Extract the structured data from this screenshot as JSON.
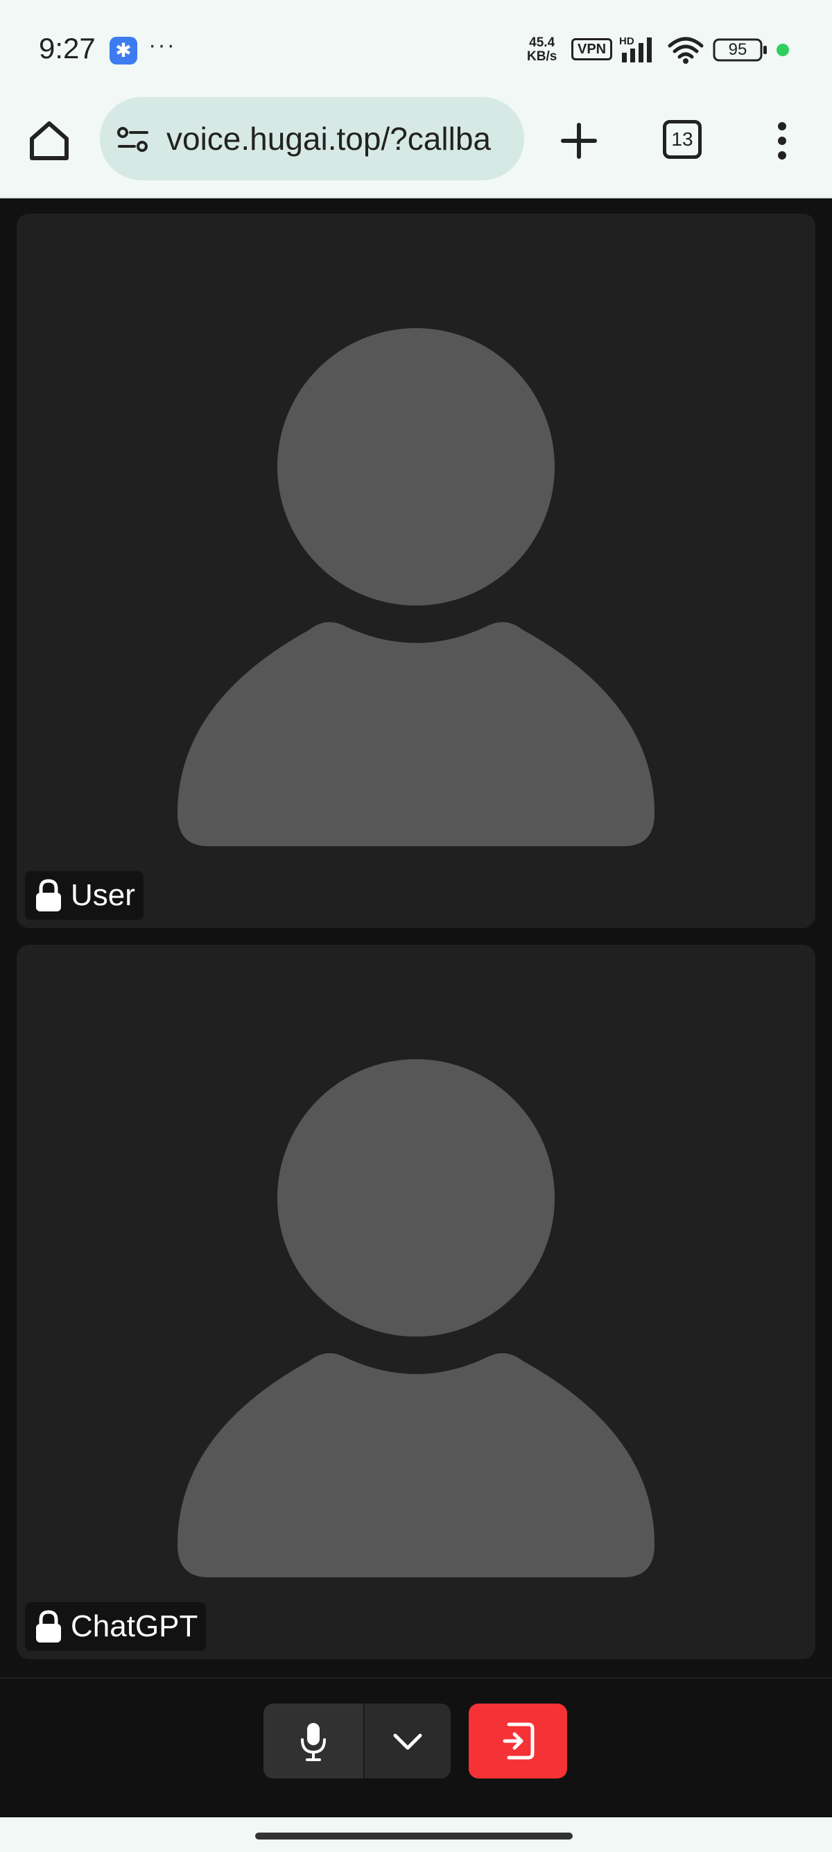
{
  "status_bar": {
    "time": "9:27",
    "app_icon": "app-notification-icon",
    "more_indicator": "···",
    "net_speed_value": "45.4",
    "net_speed_unit": "KB/s",
    "vpn_label": "VPN",
    "signal_label": "HD",
    "battery_level": "95"
  },
  "browser": {
    "url": "voice.hugai.top/?callba",
    "tab_count": "13",
    "icons": [
      "home-icon",
      "site-settings-icon",
      "plus-icon",
      "tabs-icon",
      "overflow-menu-icon"
    ]
  },
  "participants": [
    {
      "name": "User",
      "icon": "lock-icon"
    },
    {
      "name": "ChatGPT",
      "icon": "lock-icon"
    }
  ],
  "controls": {
    "icons": [
      "microphone-icon",
      "chevron-down-icon",
      "leave-icon"
    ],
    "leave_color": "#f53236"
  }
}
